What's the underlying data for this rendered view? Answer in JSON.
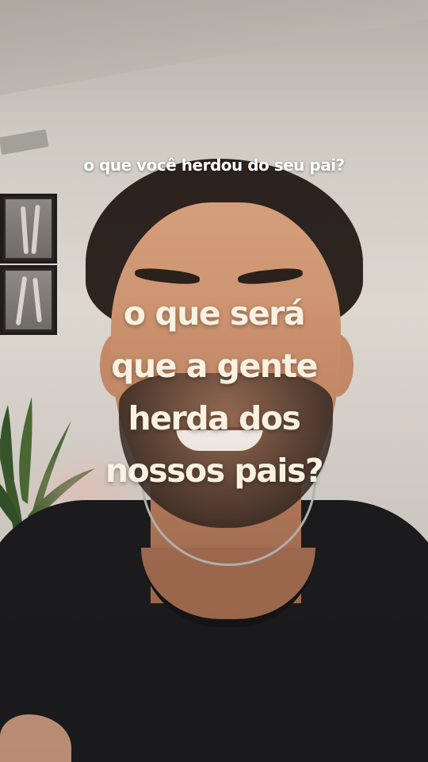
{
  "caption": {
    "top": "o que você herdou do seu pai?",
    "main_lines": [
      "o que será",
      "que a gente",
      "herda dos",
      "nossos pais?"
    ]
  },
  "colors": {
    "caption_top": "#ffffff",
    "caption_main": "#fbf1e1",
    "shirt": "#1c1b1d",
    "wall": "#d6d1c9"
  }
}
